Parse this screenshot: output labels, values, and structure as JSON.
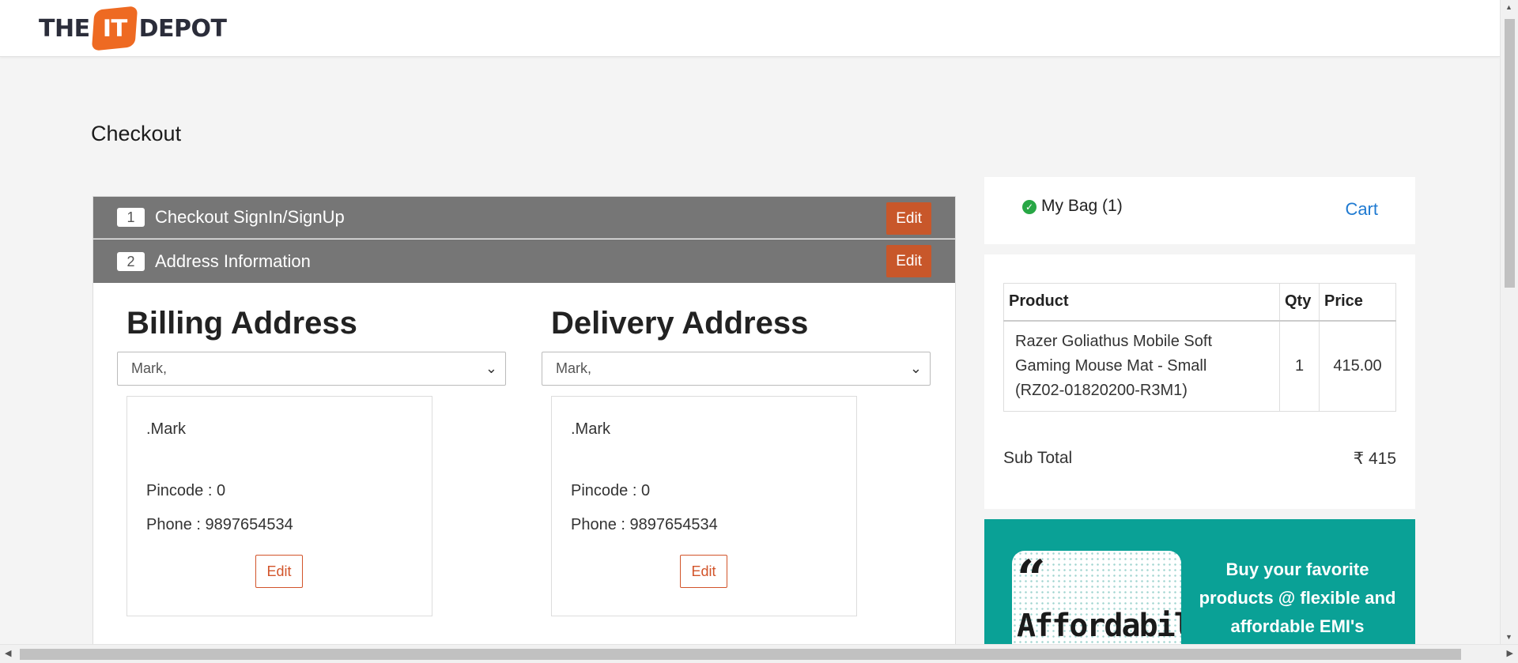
{
  "header": {
    "logo_left": "THE",
    "logo_badge": "IT",
    "logo_right": "DEPOT"
  },
  "page": {
    "title": "Checkout"
  },
  "steps": [
    {
      "number": "1",
      "label": "Checkout SignIn/SignUp",
      "edit": "Edit"
    },
    {
      "number": "2",
      "label": "Address Information",
      "edit": "Edit"
    }
  ],
  "billing": {
    "title": "Billing Address",
    "selected": "Mark,",
    "name": ".Mark",
    "pincode": "Pincode : 0",
    "phone": "Phone : 9897654534",
    "edit": "Edit"
  },
  "delivery": {
    "title": "Delivery Address",
    "selected": "Mark,",
    "name": ".Mark",
    "pincode": "Pincode : 0",
    "phone": "Phone : 9897654534",
    "edit": "Edit"
  },
  "bag": {
    "label": "My Bag (1)",
    "cart_link": "Cart"
  },
  "cart": {
    "headers": [
      "Product",
      "Qty",
      "Price"
    ],
    "rows": [
      {
        "product_line1": "Razer Goliathus Mobile Soft",
        "product_line2": "Gaming Mouse Mat - Small",
        "product_line3": "(RZ02-01820200-R3M1)",
        "qty": "1",
        "price": "415.00"
      }
    ],
    "subtotal_label": "Sub Total",
    "subtotal_value": "₹ 415"
  },
  "promo": {
    "card_word": "Affordability",
    "line1": "Buy your favorite",
    "line2": "products @ flexible and",
    "line3": "affordable EMI's"
  },
  "colors": {
    "accent": "#ee6a22",
    "step_bg": "#767676",
    "edit_button": "#c8572a",
    "promo_bg": "#0aa196",
    "link": "#1f7ad1"
  }
}
